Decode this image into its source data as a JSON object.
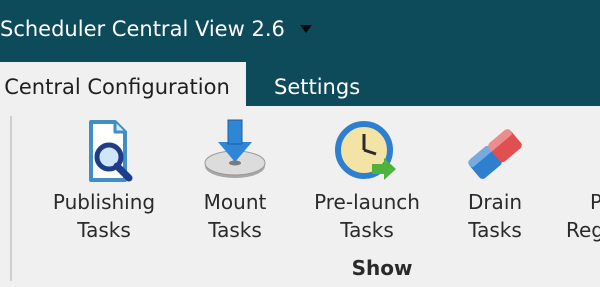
{
  "window": {
    "title": "Scheduler Central View 2.6"
  },
  "tabs": [
    {
      "label": "Central Configuration",
      "active": true
    },
    {
      "label": "Settings",
      "active": false
    }
  ],
  "ribbon": {
    "group_label": "Show",
    "buttons": [
      {
        "line1": "Publishing",
        "line2": "Tasks",
        "icon": "publishing-tasks-icon"
      },
      {
        "line1": "Mount",
        "line2": "Tasks",
        "icon": "mount-tasks-icon"
      },
      {
        "line1": "Pre-launch",
        "line2": "Tasks",
        "icon": "pre-launch-tasks-icon"
      },
      {
        "line1": "Drain",
        "line2": "Tasks",
        "icon": "drain-tasks-icon"
      },
      {
        "line1": "P",
        "line2": "Reg",
        "icon": "partial-button-icon"
      }
    ]
  },
  "colors": {
    "titlebar": "#0d4a5a",
    "ribbon_bg": "#f0f0f0"
  }
}
